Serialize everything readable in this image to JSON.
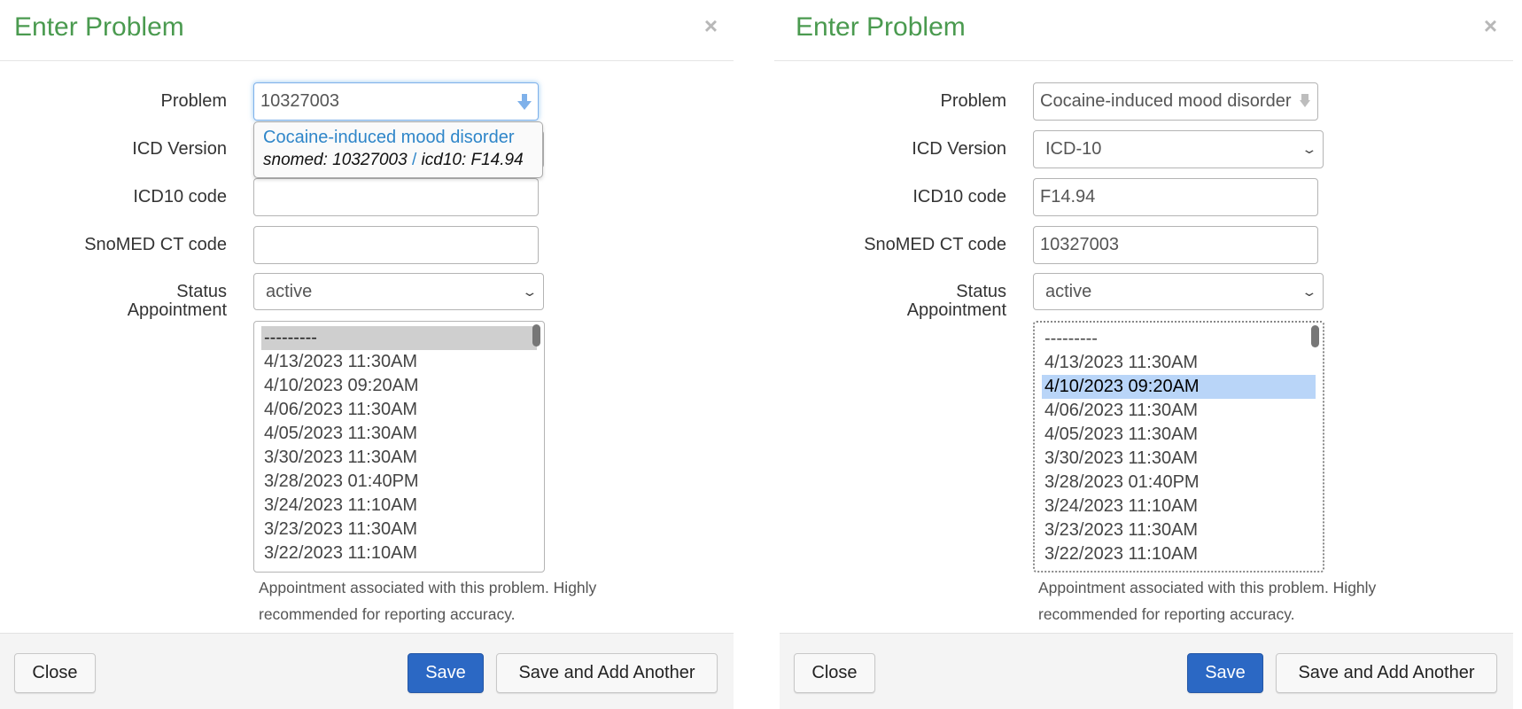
{
  "colors": {
    "title": "#4a9a4f",
    "link": "#2f86c9",
    "primary": "#2b68c4",
    "selected_row": "#b9d5f8"
  },
  "panels": [
    {
      "title": "Enter Problem",
      "close_icon": "×",
      "labels": {
        "problem": "Problem",
        "icd_version": "ICD Version",
        "icd10_code": "ICD10 code",
        "snomed_code": "SnoMED CT code",
        "status": "Status",
        "appointment": "Appointment"
      },
      "problem_value": "10327003",
      "problem_icon": "download-arrow-icon",
      "autocomplete": {
        "name": "Cocaine-induced mood disorder",
        "snomed": "snomed: 10327003",
        "separator": "/",
        "icd10": "icd10: F14.94"
      },
      "icd_version_value": "",
      "icd10_code_value": "",
      "snomed_code_value": "",
      "status_value": "active",
      "appointments": [
        "---------",
        "4/13/2023 11:30AM",
        "4/10/2023 09:20AM",
        "4/06/2023 11:30AM",
        "4/05/2023 11:30AM",
        "3/30/2023 11:30AM",
        "3/28/2023 01:40PM",
        "3/24/2023 11:10AM",
        "3/23/2023 11:30AM",
        "3/22/2023 11:10AM"
      ],
      "selected_appointment_index": 0,
      "help_text": "Appointment associated with this problem. Highly recommended for reporting accuracy.",
      "buttons": {
        "close": "Close",
        "save": "Save",
        "save_add": "Save and Add Another"
      }
    },
    {
      "title": "Enter Problem",
      "close_icon": "×",
      "labels": {
        "problem": "Problem",
        "icd_version": "ICD Version",
        "icd10_code": "ICD10 code",
        "snomed_code": "SnoMED CT code",
        "status": "Status",
        "appointment": "Appointment"
      },
      "problem_value": "Cocaine-induced mood disorder",
      "problem_icon": "dropdown-arrow-icon",
      "icd_version_value": "ICD-10",
      "icd10_code_value": "F14.94",
      "snomed_code_value": "10327003",
      "status_value": "active",
      "appointments": [
        "---------",
        "4/13/2023 11:30AM",
        "4/10/2023 09:20AM",
        "4/06/2023 11:30AM",
        "4/05/2023 11:30AM",
        "3/30/2023 11:30AM",
        "3/28/2023 01:40PM",
        "3/24/2023 11:10AM",
        "3/23/2023 11:30AM",
        "3/22/2023 11:10AM"
      ],
      "selected_appointment_index": 2,
      "help_text": "Appointment associated with this problem. Highly recommended for reporting accuracy.",
      "buttons": {
        "close": "Close",
        "save": "Save",
        "save_add": "Save and Add Another"
      }
    }
  ]
}
